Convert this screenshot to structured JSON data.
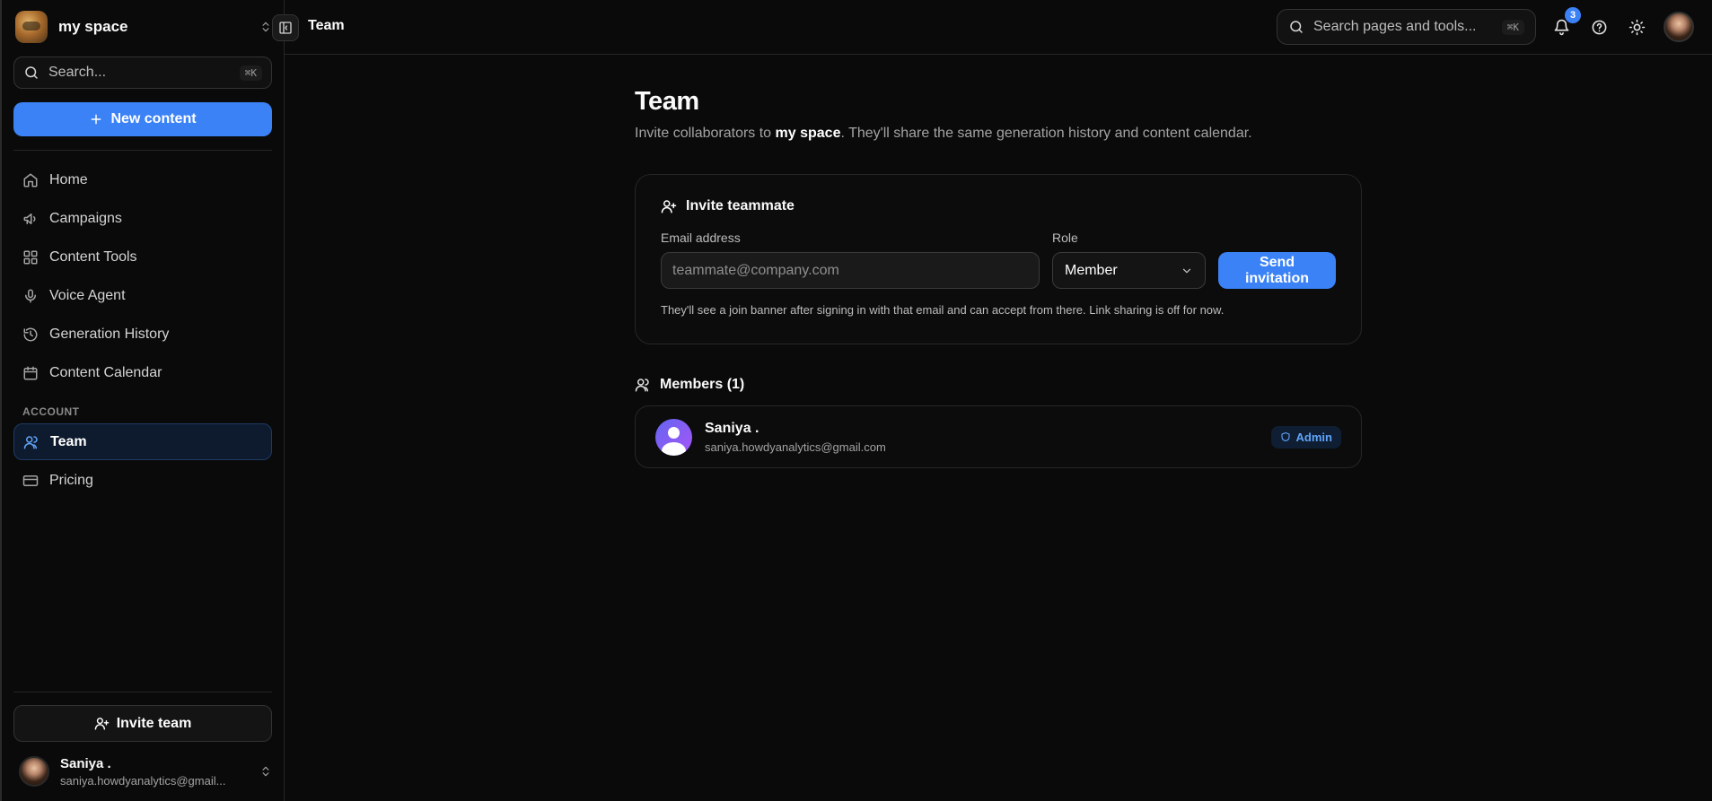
{
  "workspace": {
    "name": "my space"
  },
  "sidebar": {
    "search_label": "Search...",
    "search_shortcut": "⌘K",
    "new_content_label": "New content",
    "nav_items": [
      {
        "label": "Home",
        "icon": "home-icon"
      },
      {
        "label": "Campaigns",
        "icon": "megaphone-icon"
      },
      {
        "label": "Content Tools",
        "icon": "grid-icon"
      },
      {
        "label": "Voice Agent",
        "icon": "microphone-icon"
      },
      {
        "label": "Generation History",
        "icon": "history-icon"
      },
      {
        "label": "Content Calendar",
        "icon": "calendar-icon"
      }
    ],
    "account_label": "ACCOUNT",
    "account_items": [
      {
        "label": "Team",
        "icon": "users-icon",
        "active": true
      },
      {
        "label": "Pricing",
        "icon": "credit-card-icon"
      }
    ],
    "invite_team_label": "Invite team",
    "user": {
      "name": "Saniya .",
      "email": "saniya.howdyanalytics@gmail..."
    }
  },
  "topbar": {
    "title": "Team",
    "search_placeholder": "Search pages and tools...",
    "search_shortcut": "⌘K",
    "notifications_count": "3"
  },
  "page": {
    "title": "Team",
    "subtitle_prefix": "Invite collaborators to ",
    "subtitle_workspace": "my space",
    "subtitle_suffix": ". They'll share the same generation history and content calendar."
  },
  "invite": {
    "title": "Invite teammate",
    "email_label": "Email address",
    "email_placeholder": "teammate@company.com",
    "role_label": "Role",
    "role_value": "Member",
    "send_label": "Send invitation",
    "hint": "They'll see a join banner after signing in with that email and can accept from there. Link sharing is off for now."
  },
  "members": {
    "heading": "Members (1)",
    "list": [
      {
        "name": "Saniya .",
        "email": "saniya.howdyanalytics@gmail.com",
        "role": "Admin"
      }
    ]
  },
  "colors": {
    "accent": "#3b82f6",
    "background": "#0a0a0a",
    "border": "#262626"
  }
}
